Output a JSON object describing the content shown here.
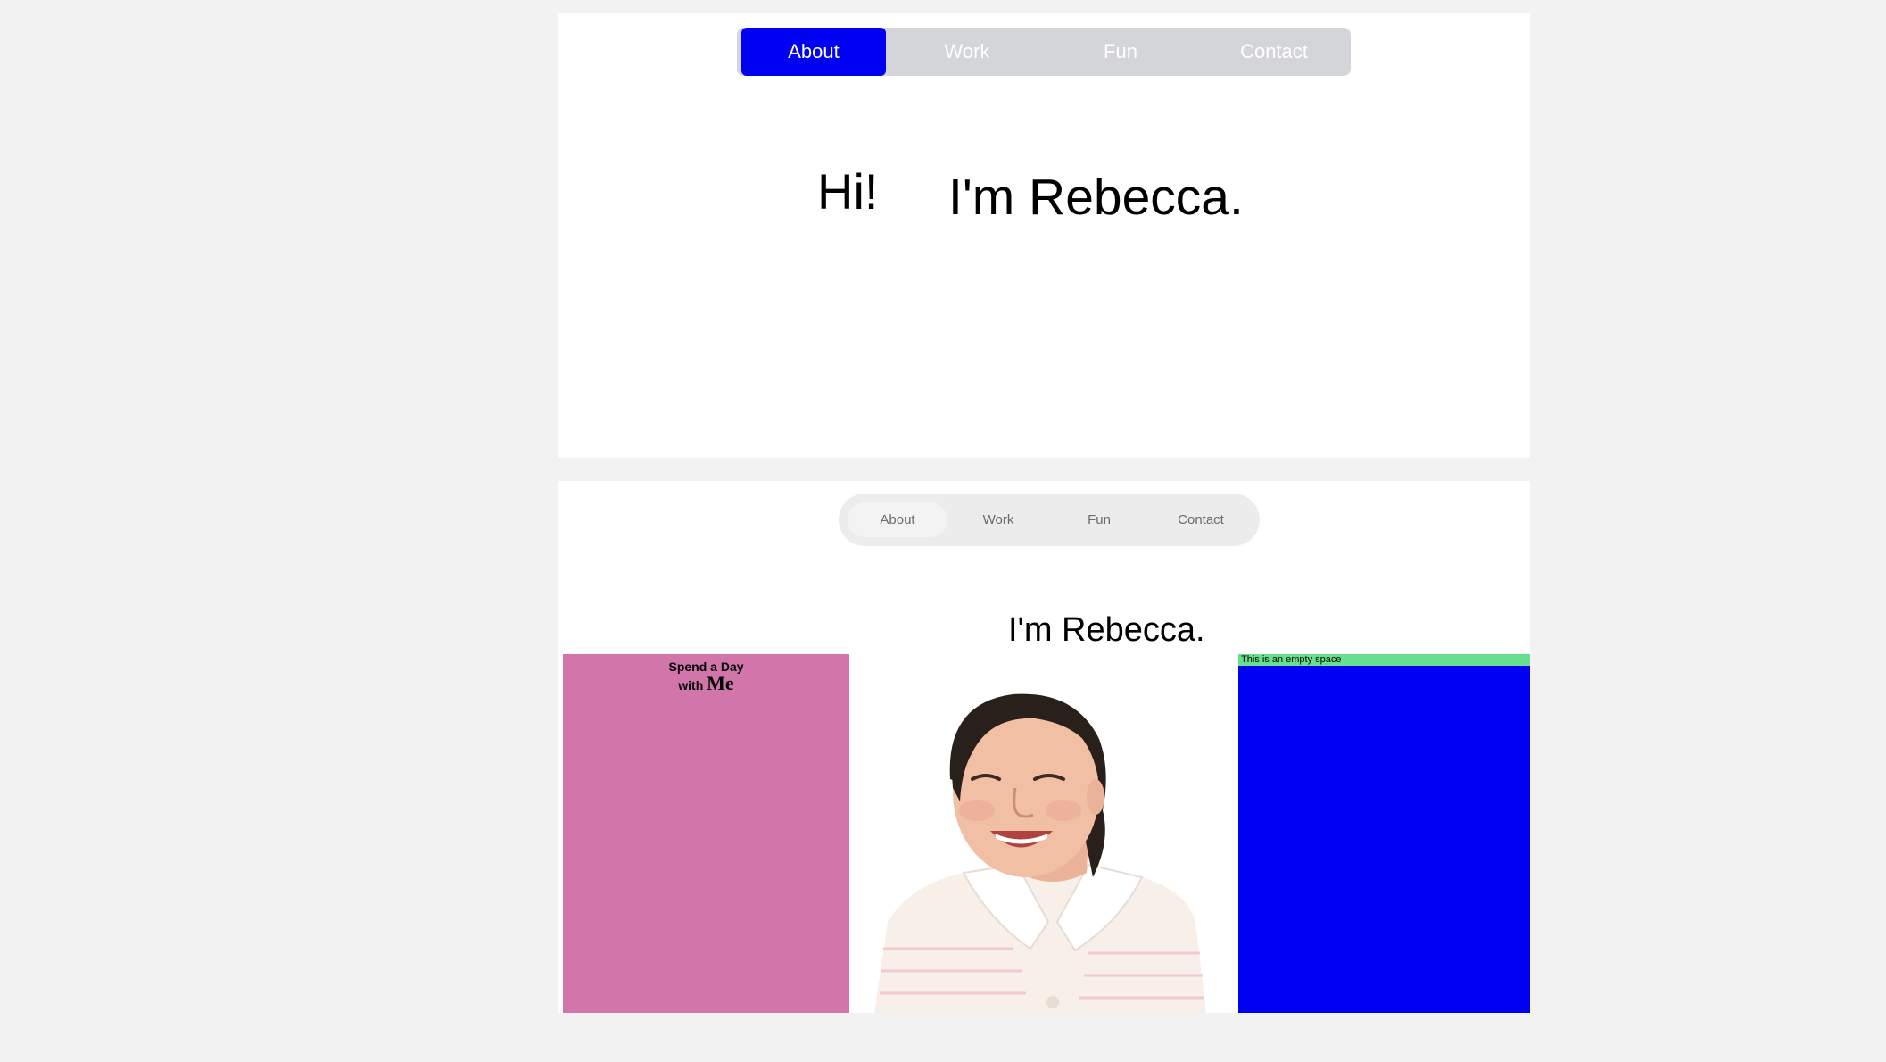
{
  "top_section": {
    "nav": {
      "items": [
        "About",
        "Work",
        "Fun",
        "Contact"
      ],
      "active": "About",
      "active_color": "#0000f2",
      "bar_color": "#d4d5d9"
    },
    "greeting": "Hi!",
    "intro": "I'm Rebecca."
  },
  "bottom_section": {
    "nav": {
      "items": [
        "About",
        "Work",
        "Fun",
        "Contact"
      ],
      "active": "About"
    },
    "intro": "I'm Rebecca.",
    "pink_card": {
      "line1": "Spend a Day",
      "line2_prefix": "with ",
      "line2_emphasis": "Me",
      "color": "#d175aa"
    },
    "portrait": {
      "alt": "Portrait photo of Rebecca smiling"
    },
    "blue_card": {
      "caption": "This is an empty space",
      "color": "#0000f2",
      "band_color": "#66e08e"
    }
  }
}
